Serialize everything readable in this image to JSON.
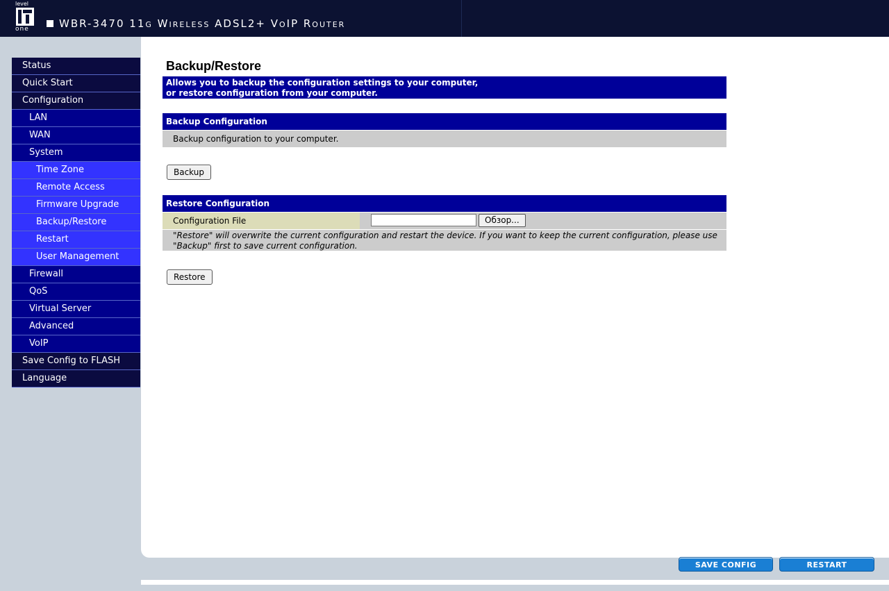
{
  "header": {
    "logo_top": "level",
    "logo_bottom": "one",
    "title": "WBR-3470 11g Wireless ADSL2+ VoIP Router"
  },
  "nav": {
    "items": [
      {
        "label": "Status"
      },
      {
        "label": "Quick Start"
      },
      {
        "label": "Configuration"
      },
      {
        "label": "LAN"
      },
      {
        "label": "WAN"
      },
      {
        "label": "System"
      },
      {
        "label": "Time Zone"
      },
      {
        "label": "Remote Access"
      },
      {
        "label": "Firmware Upgrade"
      },
      {
        "label": "Backup/Restore"
      },
      {
        "label": "Restart"
      },
      {
        "label": "User Management"
      },
      {
        "label": "Firewall"
      },
      {
        "label": "QoS"
      },
      {
        "label": "Virtual Server"
      },
      {
        "label": "Advanced"
      },
      {
        "label": "VoIP"
      },
      {
        "label": "Save Config to FLASH"
      },
      {
        "label": "Language"
      }
    ]
  },
  "page": {
    "title": "Backup/Restore",
    "desc_line1": "Allows you to backup the configuration settings to your computer,",
    "desc_line2": "or restore configuration from your computer."
  },
  "backup": {
    "section_title": "Backup Configuration",
    "description": "Backup configuration to your computer.",
    "button_label": "Backup"
  },
  "restore": {
    "section_title": "Restore Configuration",
    "file_label": "Configuration File",
    "file_value": "",
    "browse_label": "Обзор...",
    "note_line1": "\"Restore\" will overwrite the current configuration and restart the device. If you want to keep the current configuration, please use",
    "note_line2": "\"Backup\" first to save current configuration.",
    "button_label": "Restore"
  },
  "footer": {
    "save_label": "SAVE CONFIG",
    "restart_label": "RESTART"
  },
  "colors": {
    "header_bg": "#0c1232",
    "nav_level0": "#0b0b40",
    "nav_level1": "#00008d",
    "nav_level2": "#3333ff",
    "section_bar": "#000099",
    "footer_button": "#1a7fd4"
  }
}
